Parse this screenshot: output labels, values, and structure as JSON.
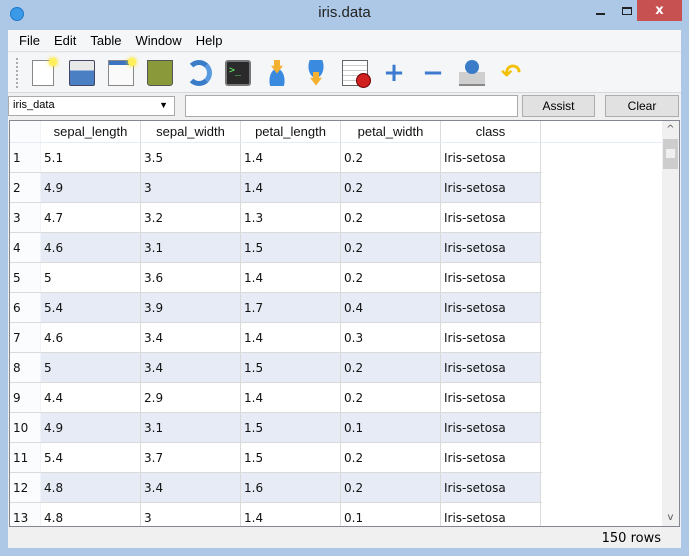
{
  "window": {
    "title": "iris.data",
    "minimize_label": "",
    "maximize_label": "",
    "close_label": "x"
  },
  "menu": [
    "File",
    "Edit",
    "Table",
    "Window",
    "Help"
  ],
  "toolbar": {
    "icons": [
      "new-table-icon",
      "open-folder-icon",
      "new-window-icon",
      "trash-icon",
      "refresh-icon",
      "terminal-icon",
      "import-database-icon",
      "export-database-icon",
      "report-chart-icon",
      "add-row-icon",
      "remove-row-icon",
      "save-to-drive-icon",
      "undo-icon"
    ],
    "terminal_glyph": ">_",
    "plus_glyph": "+",
    "minus_glyph": "−",
    "undo_glyph": "↶"
  },
  "query": {
    "table_select": "iris_data",
    "select_arrow": "▼",
    "input_value": "",
    "assist_label": "Assist",
    "clear_label": "Clear"
  },
  "table": {
    "columns": [
      "",
      "sepal_length",
      "sepal_width",
      "petal_length",
      "petal_width",
      "class"
    ],
    "rows": [
      [
        "1",
        "5.1",
        "3.5",
        "1.4",
        "0.2",
        "Iris-setosa"
      ],
      [
        "2",
        "4.9",
        "3",
        "1.4",
        "0.2",
        "Iris-setosa"
      ],
      [
        "3",
        "4.7",
        "3.2",
        "1.3",
        "0.2",
        "Iris-setosa"
      ],
      [
        "4",
        "4.6",
        "3.1",
        "1.5",
        "0.2",
        "Iris-setosa"
      ],
      [
        "5",
        "5",
        "3.6",
        "1.4",
        "0.2",
        "Iris-setosa"
      ],
      [
        "6",
        "5.4",
        "3.9",
        "1.7",
        "0.4",
        "Iris-setosa"
      ],
      [
        "7",
        "4.6",
        "3.4",
        "1.4",
        "0.3",
        "Iris-setosa"
      ],
      [
        "8",
        "5",
        "3.4",
        "1.5",
        "0.2",
        "Iris-setosa"
      ],
      [
        "9",
        "4.4",
        "2.9",
        "1.4",
        "0.2",
        "Iris-setosa"
      ],
      [
        "10",
        "4.9",
        "3.1",
        "1.5",
        "0.1",
        "Iris-setosa"
      ],
      [
        "11",
        "5.4",
        "3.7",
        "1.5",
        "0.2",
        "Iris-setosa"
      ],
      [
        "12",
        "4.8",
        "3.4",
        "1.6",
        "0.2",
        "Iris-setosa"
      ],
      [
        "13",
        "4.8",
        "3",
        "1.4",
        "0.1",
        "Iris-setosa"
      ]
    ],
    "scroll_up": "^",
    "scroll_down": "v"
  },
  "status": {
    "row_count": "150 rows"
  }
}
